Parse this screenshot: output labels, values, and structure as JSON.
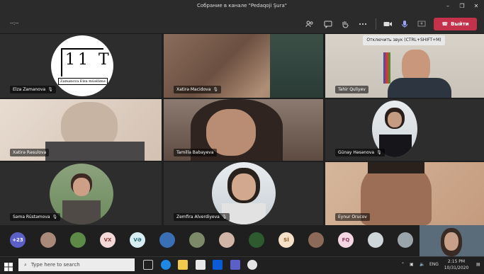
{
  "window": {
    "title": "Собрание в канале \"Pedaqoji Şura\""
  },
  "toolbar": {
    "timer": "--:--",
    "leave_label": "Выйти",
    "tooltip": "Отключить звук (CTRL+SHIFT+M)"
  },
  "tiles": [
    {
      "name": "Elza Zamanova",
      "logo_big": "11 T",
      "logo_sub": "Zamanova Elza müəllimə"
    },
    {
      "name": "Xatirə Macidova"
    },
    {
      "name": "Tahir Quliyev"
    },
    {
      "name": "Xatirə Rəsulova"
    },
    {
      "name": "Tamilla Babayeva"
    },
    {
      "name": "Günay Həsənova"
    },
    {
      "name": "Səma Rüstəmova"
    },
    {
      "name": "Zemfira Alverdiyeva"
    },
    {
      "name": "Eynur Orucov"
    }
  ],
  "participants": {
    "overflow": "+23",
    "initials": [
      "VX",
      "VƏ",
      "Sİ",
      "FQ"
    ]
  },
  "taskbar": {
    "search_placeholder": "Type here to search",
    "language": "ENG",
    "time": "2:15 PM",
    "date": "10/31/2020"
  }
}
